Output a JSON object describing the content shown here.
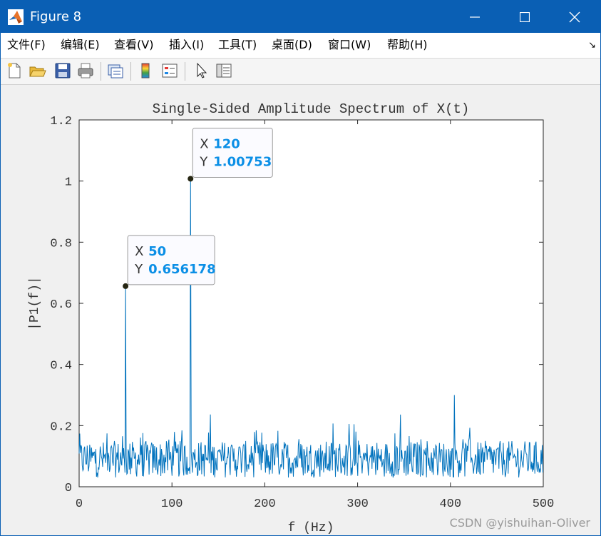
{
  "window": {
    "title": "Figure 8",
    "icon": "matlab-logo-icon",
    "controls": [
      "minimize-icon",
      "maximize-icon",
      "close-icon"
    ]
  },
  "menu": {
    "items": [
      "文件(F)",
      "编辑(E)",
      "查看(V)",
      "插入(I)",
      "工具(T)",
      "桌面(D)",
      "窗口(W)",
      "帮助(H)"
    ],
    "dock_icon": "↘"
  },
  "toolbar": {
    "buttons": [
      "new-figure-icon",
      "open-file-icon",
      "save-icon",
      "print-icon",
      "link-plot-icon",
      "colorbar-icon",
      "legend-icon",
      "edit-plot-pointer-icon",
      "property-inspector-icon"
    ]
  },
  "colors": {
    "titlebar": "#0a5fb4",
    "series": "#0072bd",
    "datatip_value": "#0b8fe6"
  },
  "chart_data": {
    "type": "line",
    "title": "Single-Sided Amplitude Spectrum of X(t)",
    "xlabel": "f (Hz)",
    "ylabel": "|P1(f)|",
    "xlim": [
      0,
      500
    ],
    "ylim": [
      0,
      1.2
    ],
    "xticks": [
      "0",
      "100",
      "200",
      "300",
      "400",
      "500"
    ],
    "yticks": [
      "0",
      "0.2",
      "0.4",
      "0.6",
      "0.8",
      "1",
      "1.2"
    ],
    "grid": false,
    "series": [
      {
        "description": "noisy amplitude spectrum, roughly 0.02-0.25 baseline with peaks",
        "peaks": [
          {
            "x": 50,
            "y": 0.656178
          },
          {
            "x": 120,
            "y": 1.00753
          },
          {
            "x": 404,
            "y": 0.3
          }
        ],
        "noise_range": [
          0.0,
          0.25
        ]
      }
    ],
    "datatips": [
      {
        "x_label": "X",
        "x_value": "120",
        "y_label": "Y",
        "y_value": "1.00753",
        "x": 120,
        "y": 1.00753
      },
      {
        "x_label": "X",
        "x_value": "50",
        "y_label": "Y",
        "y_value": "0.656178",
        "x": 50,
        "y": 0.656178
      }
    ]
  },
  "watermark": "CSDN @yishuihan-Oliver"
}
